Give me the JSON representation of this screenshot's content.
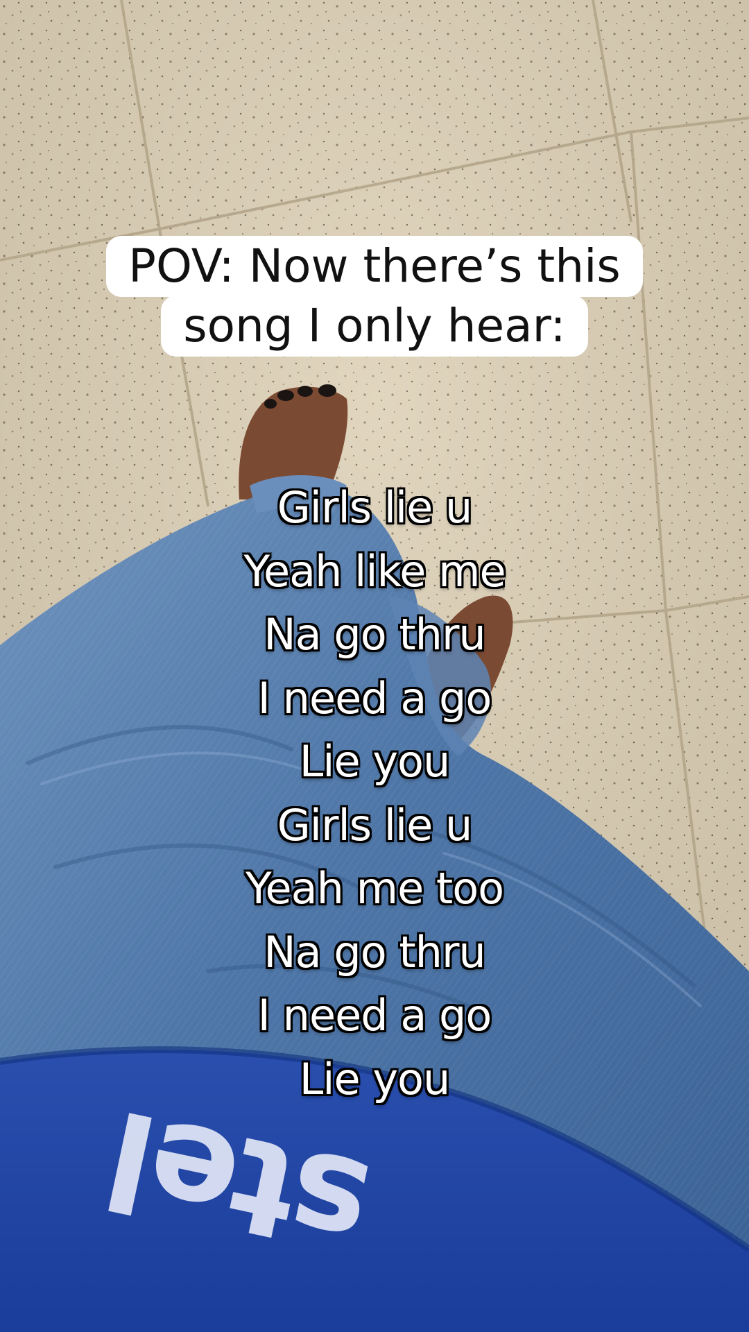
{
  "caption": {
    "lines": [
      "POV: Now there’s this",
      "song I only hear:"
    ]
  },
  "lyrics": [
    "Girls lie u",
    "Yeah like me",
    "Na go thru",
    "I need a go",
    "Lie you",
    "Girls lie u",
    "Yeah me too",
    "Na go thru",
    "I need a go",
    "Lie you"
  ],
  "shirt_print": "stel",
  "colors": {
    "floor_tile": "#ddd0b6",
    "grout": "#b9ab90",
    "denim": "#4f76a6",
    "shirt": "#1f45a8",
    "skin": "#7a4a32",
    "caption_bg": "#ffffff",
    "lyric_text": "#ffffff",
    "lyric_outline": "#000000"
  }
}
